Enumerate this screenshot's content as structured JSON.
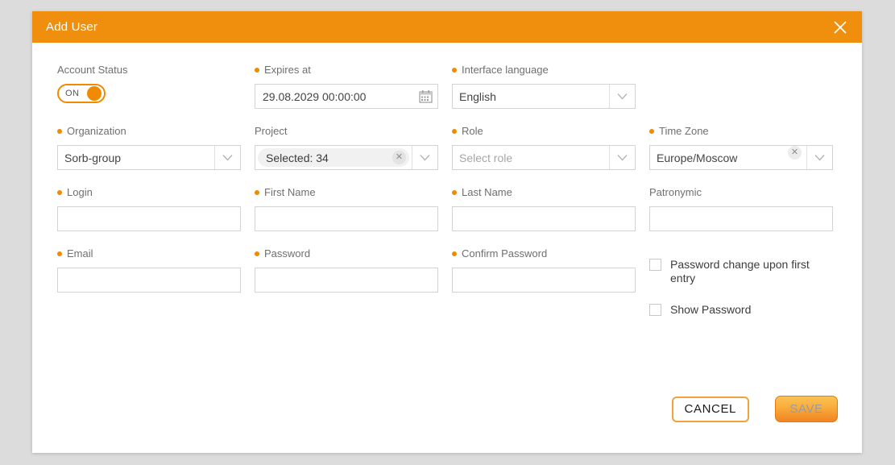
{
  "modal": {
    "title": "Add User",
    "close_icon": "close-icon"
  },
  "fields": {
    "account_status": {
      "label": "Account Status",
      "required": false,
      "toggle_state": "ON"
    },
    "expires_at": {
      "label": "Expires at",
      "required": true,
      "value": "29.08.2029 00:00:00",
      "icon": "calendar-icon"
    },
    "interface_language": {
      "label": "Interface language",
      "required": true,
      "value": "English"
    },
    "organization": {
      "label": "Organization",
      "required": true,
      "value": "Sorb-group"
    },
    "project": {
      "label": "Project",
      "required": false,
      "value": "Selected: 34",
      "clear_icon": "clear-icon"
    },
    "role": {
      "label": "Role",
      "required": true,
      "value": "",
      "placeholder": "Select role"
    },
    "time_zone": {
      "label": "Time Zone",
      "required": true,
      "value": "Europe/Moscow",
      "clear_icon": "clear-icon"
    },
    "login": {
      "label": "Login",
      "required": true,
      "value": "",
      "placeholder": ""
    },
    "first_name": {
      "label": "First Name",
      "required": true,
      "value": "",
      "placeholder": ""
    },
    "last_name": {
      "label": "Last Name",
      "required": true,
      "value": "",
      "placeholder": ""
    },
    "patronymic": {
      "label": "Patronymic",
      "required": false,
      "value": "",
      "placeholder": ""
    },
    "email": {
      "label": "Email",
      "required": true,
      "value": "",
      "placeholder": ""
    },
    "password": {
      "label": "Password",
      "required": true,
      "value": "",
      "placeholder": ""
    },
    "confirm_password": {
      "label": "Confirm Password",
      "required": true,
      "value": "",
      "placeholder": ""
    }
  },
  "checkboxes": [
    {
      "label": "Password change upon first entry",
      "checked": false
    },
    {
      "label": "Show Password",
      "checked": false
    }
  ],
  "footer": {
    "cancel_label": "CANCEL",
    "save_label": "SAVE",
    "save_disabled": true
  },
  "colors": {
    "brand_orange": "#ef8f0d",
    "required_dot": "#f08a00",
    "page_background": "#dcdcdc",
    "modal_background": "#ffffff",
    "input_border": "#d3d3d3",
    "label_text": "#6f6f6f",
    "value_text": "#444444",
    "placeholder_text": "#a6a6a6",
    "save_disabled_text": "#9c9c9c"
  }
}
